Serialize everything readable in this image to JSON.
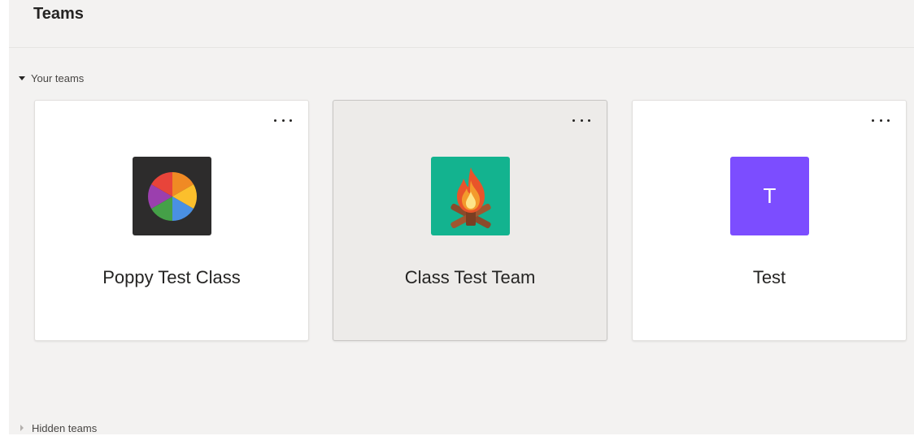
{
  "header": {
    "title": "Teams"
  },
  "sections": {
    "your_teams": {
      "label": "Your teams",
      "expanded": true
    },
    "hidden_teams": {
      "label": "Hidden teams",
      "expanded": false
    }
  },
  "teams": [
    {
      "name": "Poppy Test Class",
      "avatar_icon": "pie-chart-icon",
      "avatar_bg": "#2d2c2c",
      "avatar_colors": [
        "#e8443a",
        "#f08a24",
        "#fbbf2c",
        "#4a90e2",
        "#45a048",
        "#9b3fae"
      ]
    },
    {
      "name": "Class Test Team",
      "avatar_icon": "campfire-icon",
      "avatar_bg": "#13b38f",
      "selected": true
    },
    {
      "name": "Test",
      "avatar_letter": "T",
      "avatar_bg": "#7c4dff"
    }
  ],
  "icons": {
    "more_options": "more-options-icon"
  },
  "colors": {
    "page_background": "#f3f2f1",
    "card_background": "#ffffff",
    "card_selected_background": "#edebe9",
    "text_primary": "#252423"
  }
}
